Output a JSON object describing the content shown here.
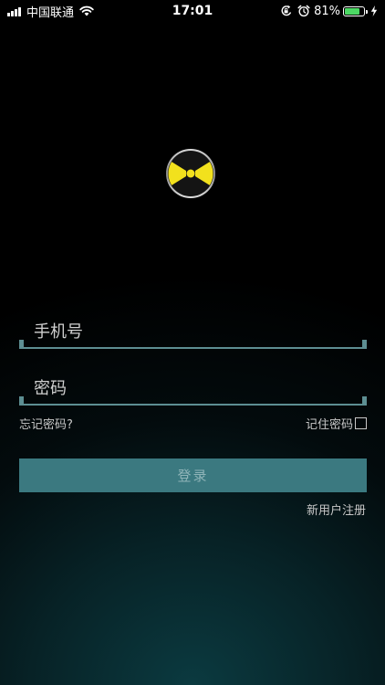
{
  "status_bar": {
    "carrier": "中国联通",
    "time": "17:01",
    "battery_percent": "81%",
    "battery_level": 0.81,
    "battery_color": "#4cd964"
  },
  "logo": {
    "icon": "bowtie-logo-icon",
    "accent_color": "#f2e11d"
  },
  "login_form": {
    "username_placeholder": "手机号",
    "password_placeholder": "密码",
    "forgot_password": "忘记密码?",
    "remember_password": "记住密码",
    "login_button": "登录",
    "register_link": "新用户注册"
  },
  "colors": {
    "button_bg": "#3b7980",
    "field_line": "#5d8e92"
  }
}
